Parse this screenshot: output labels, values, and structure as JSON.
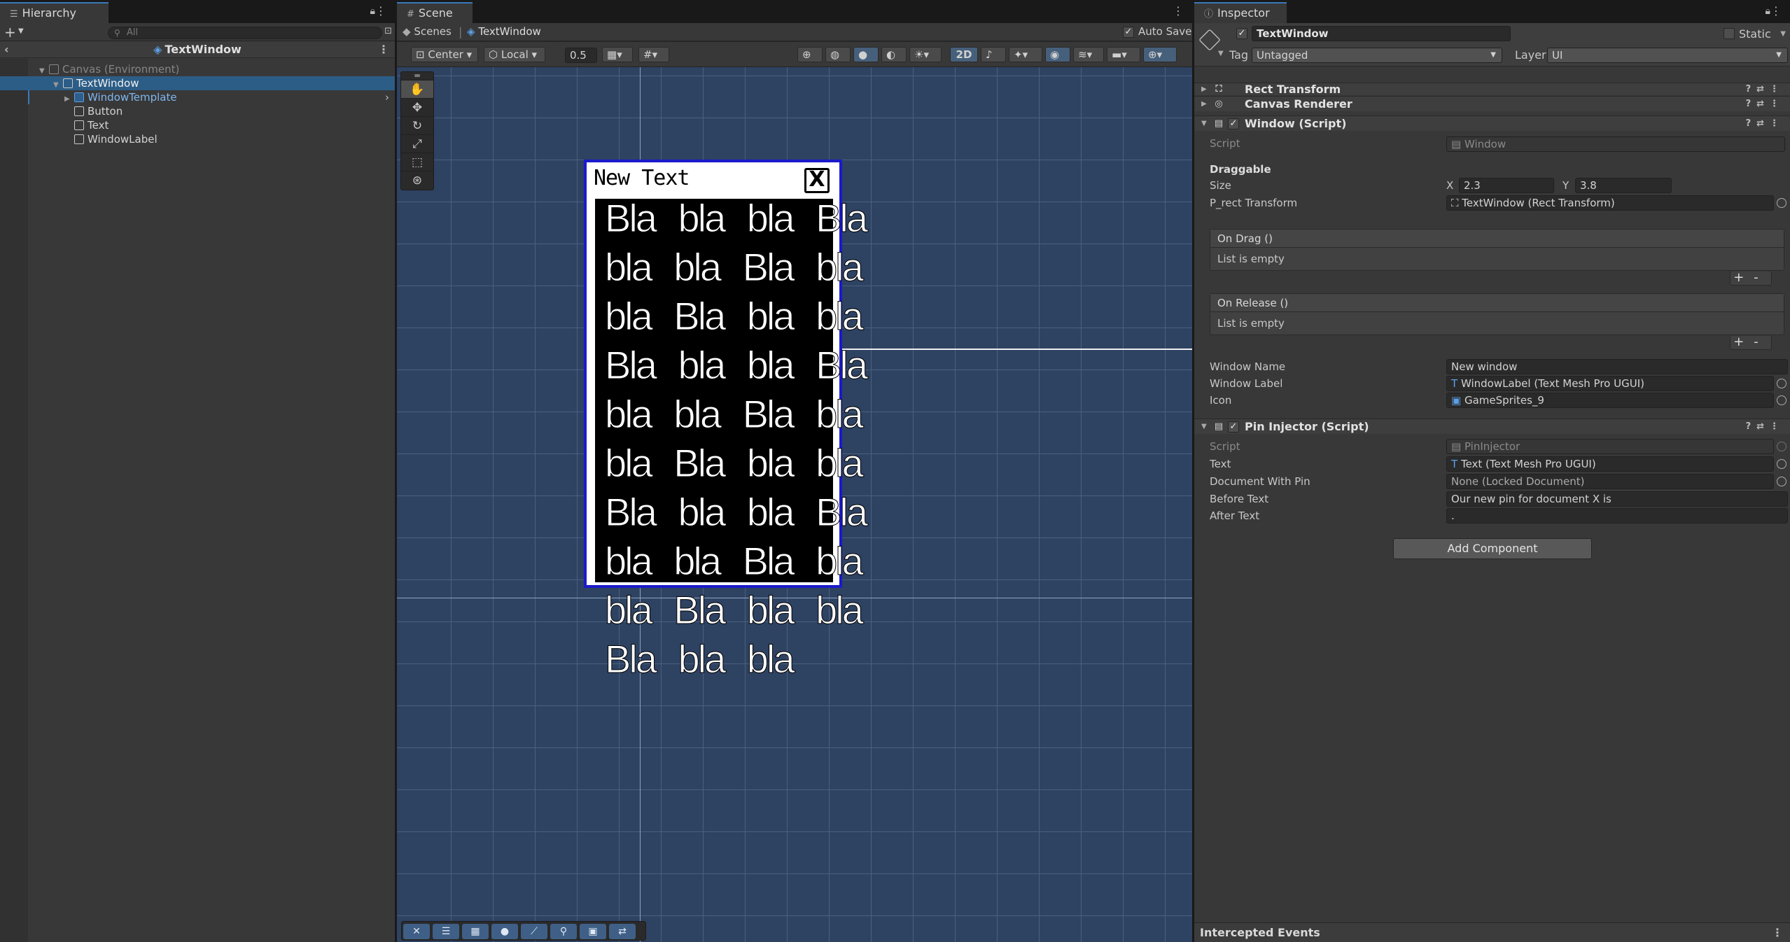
{
  "hierarchy": {
    "tab_label": "Hierarchy",
    "search_placeholder": "All",
    "prefab_title": "TextWindow",
    "items": [
      {
        "label": "Canvas (Environment)"
      },
      {
        "label": "TextWindow"
      },
      {
        "label": "WindowTemplate"
      },
      {
        "label": "Button"
      },
      {
        "label": "Text"
      },
      {
        "label": "WindowLabel"
      }
    ]
  },
  "scene": {
    "tab_label": "Scene",
    "breadcrumb_root": "Scenes",
    "breadcrumb_current": "TextWindow",
    "auto_save_label": "Auto Save",
    "pivot_label": "Center",
    "space_label": "Local",
    "snap_value": "0.5",
    "mode_2d_label": "2D",
    "window_title": "New Text",
    "window_close_glyph": "X",
    "body_rows": [
      "Bla bla bla Bla",
      "bla bla Bla bla",
      "bla Bla bla bla",
      "Bla bla bla Bla",
      "bla bla Bla bla",
      "bla Bla bla bla",
      "Bla bla bla Bla",
      "bla bla Bla bla",
      "bla Bla bla bla",
      "Bla bla bla"
    ]
  },
  "inspector": {
    "tab_label": "Inspector",
    "object_name": "TextWindow",
    "static_label": "Static",
    "tag_label": "Tag",
    "tag_value": "Untagged",
    "layer_label": "Layer",
    "layer_value": "UI",
    "components": {
      "rect_transform": "Rect Transform",
      "canvas_renderer": "Canvas Renderer",
      "window_script": "Window (Script)",
      "pin_injector": "Pin Injector (Script)"
    },
    "window": {
      "script_label": "Script",
      "script_value": "Window",
      "draggable_label": "Draggable",
      "size_label": "Size",
      "size_x_label": "X",
      "size_x": "2.3",
      "size_y_label": "Y",
      "size_y": "3.8",
      "prect_label": "P_rect Transform",
      "prect_value": "TextWindow (Rect Transform)",
      "on_drag_label": "On Drag ()",
      "on_drag_empty": "List is empty",
      "on_release_label": "On Release ()",
      "on_release_empty": "List is empty",
      "plus": "+",
      "minus": "-",
      "window_name_label": "Window Name",
      "window_name_value": "New window",
      "window_label_label": "Window Label",
      "window_label_value": "WindowLabel (Text Mesh Pro UGUI)",
      "icon_label": "Icon",
      "icon_value": "GameSprites_9"
    },
    "pin": {
      "script_label": "Script",
      "script_value": "PinInjector",
      "text_label": "Text",
      "text_value": "Text (Text Mesh Pro UGUI)",
      "doc_label": "Document With Pin",
      "doc_value": "None (Locked Document)",
      "before_label": "Before Text",
      "before_value": "Our new pin for document X is",
      "after_label": "After Text",
      "after_value": "."
    },
    "add_component_label": "Add Component",
    "footer_label": "Intercepted Events"
  }
}
